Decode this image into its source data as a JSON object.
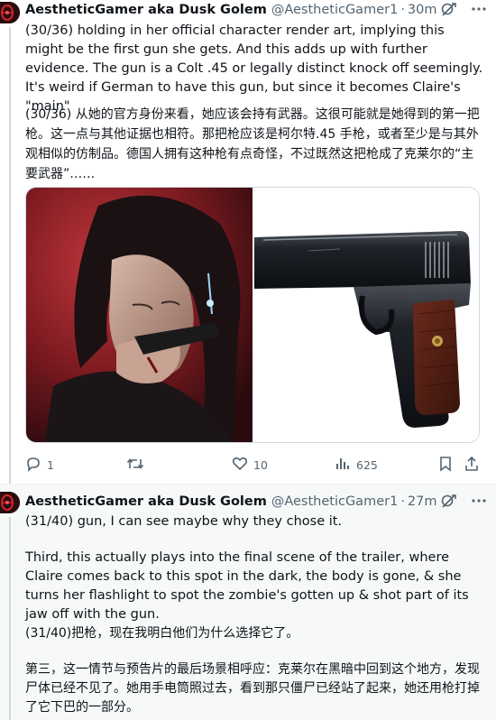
{
  "tweets": [
    {
      "author_name": "AestheticGamer aka Dusk Golem",
      "handle": "@AestheticGamer1",
      "separator": "·",
      "time": "30m",
      "text_en": "(30/36) holding in her official character render art, implying this might be the first gun she gets. And this adds up with further evidence. The gun is a Colt .45 or legally distinct knock off seemingly. It's weird if German to have this gun, but since it becomes Claire's \"main\"",
      "text_zh": "(30/36) 从她的官方身份来看，她应该会持有武器。这很可能就是她得到的第一把枪。这一点与其他证据也相符。那把枪应该是柯尔特.45 手枪，或者至少是与其外观相似的仿制品。德国人拥有这种枪有点奇怪，不过既然这把枪成了克莱尔的“主要武器”……",
      "replies": "1",
      "retweets": "",
      "likes": "10",
      "views": "625"
    },
    {
      "author_name": "AestheticGamer aka Dusk Golem",
      "handle": "@AestheticGamer1",
      "separator": "·",
      "time": "27m",
      "text_en_1": "(31/40) gun, I can see maybe why they chose it.",
      "text_en_2": "Third, this actually plays into the final scene of the trailer, where Claire comes back to this spot in the dark, the body is gone, & she turns her flashlight to spot the zombie's gotten up & shot part of its jaw off with the gun.",
      "text_zh_1": "(31/40)把枪，现在我明白他们为什么选择它了。",
      "text_zh_2": "第三，这一情节与预告片的最后场景相呼应：克莱尔在黑暗中回到这个地方，发现尸体已经不见了。她用手电筒照过去，看到那只僵尸已经站了起来，她还用枪打掉了它下巴的一部分。"
    }
  ],
  "icons": {
    "translate": "translate-icon",
    "more": "more-icon",
    "reply": "reply-icon",
    "retweet": "retweet-icon",
    "like": "like-icon",
    "views": "views-icon",
    "bookmark": "bookmark-icon",
    "share": "share-icon"
  },
  "colors": {
    "text": "#0f1419",
    "muted": "#536471",
    "second_tweet_bg": "#f7f9f9",
    "border": "#cfd9de"
  }
}
